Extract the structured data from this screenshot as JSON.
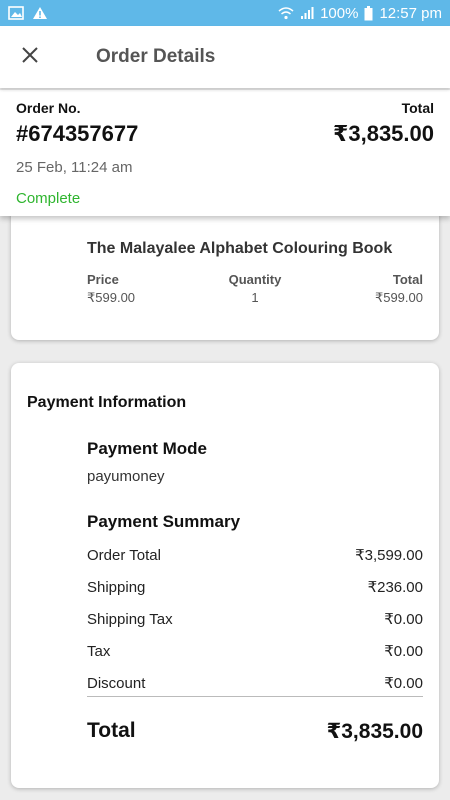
{
  "status_bar": {
    "battery": "100%",
    "time": "12:57 pm",
    "icons": [
      "image-icon",
      "warning-icon",
      "wifi-icon",
      "signal-icon",
      "battery-icon"
    ]
  },
  "app_bar": {
    "title": "Order Details",
    "close_icon": "close-icon"
  },
  "order": {
    "number_label": "Order No.",
    "number": "#674357677",
    "total_label": "Total",
    "total": "₹3,835.00",
    "date": "25 Feb, 11:24 am",
    "status": "Complete",
    "status_color": "#2fb52f"
  },
  "item": {
    "title": "The Malayalee Alphabet Colouring Book",
    "price_label": "Price",
    "price": "₹599.00",
    "quantity_label": "Quantity",
    "quantity": "1",
    "total_label": "Total",
    "total": "₹599.00"
  },
  "payment": {
    "title": "Payment Information",
    "mode_label": "Payment Mode",
    "mode": "payumoney",
    "summary_label": "Payment Summary",
    "rows": [
      {
        "label": "Order Total",
        "value": "₹3,599.00"
      },
      {
        "label": "Shipping",
        "value": "₹236.00"
      },
      {
        "label": "Shipping Tax",
        "value": "₹0.00"
      },
      {
        "label": "Tax",
        "value": "₹0.00"
      },
      {
        "label": "Discount",
        "value": "₹0.00"
      }
    ],
    "total_label": "Total",
    "total": "₹3,835.00"
  },
  "colors": {
    "status_bar": "#5fb8e8",
    "background": "#ececec",
    "complete_green": "#2fb52f"
  }
}
